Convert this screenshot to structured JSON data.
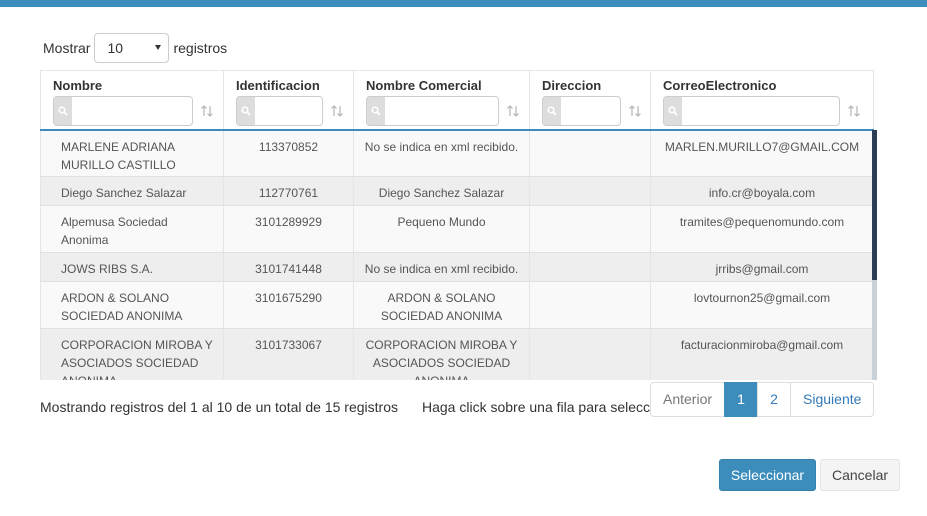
{
  "length": {
    "label_before": "Mostrar",
    "value": "10",
    "label_after": "registros"
  },
  "table": {
    "columns": [
      {
        "label": "Nombre"
      },
      {
        "label": "Identificacion"
      },
      {
        "label": "Nombre Comercial"
      },
      {
        "label": "Direccion"
      },
      {
        "label": "CorreoElectronico"
      }
    ],
    "rows": [
      [
        "MARLENE ADRIANA MURILLO CASTILLO",
        "113370852",
        "No se indica en xml recibido.",
        "",
        "MARLEN.MURILLO7@GMAIL.COM"
      ],
      [
        "Diego Sanchez Salazar",
        "112770761",
        "Diego Sanchez Salazar",
        "",
        "info.cr@boyala.com"
      ],
      [
        "Alpemusa Sociedad Anonima",
        "3101289929",
        "Pequeno Mundo",
        "",
        "tramites@pequenomundo.com"
      ],
      [
        "JOWS RIBS S.A.",
        "3101741448",
        "No se indica en xml recibido.",
        "",
        "jrribs@gmail.com"
      ],
      [
        "ARDON & SOLANO SOCIEDAD ANONIMA",
        "3101675290",
        "ARDON & SOLANO SOCIEDAD ANONIMA",
        "",
        "lovtournon25@gmail.com"
      ],
      [
        "CORPORACION MIROBA Y ASOCIADOS SOCIEDAD ANONIMA",
        "3101733067",
        "CORPORACION MIROBA Y ASOCIADOS SOCIEDAD ANONIMA",
        "",
        "facturacionmiroba@gmail.com"
      ]
    ]
  },
  "info": "Mostrando registros del 1 al 10 de un total de 15 registros",
  "hint": "Haga click sobre una fila para seleccionar",
  "pagination": {
    "prev": "Anterior",
    "page1": "1",
    "page2": "2",
    "next": "Siguiente"
  },
  "buttons": {
    "select": "Seleccionar",
    "cancel": "Cancelar"
  },
  "colors": {
    "accent": "#3c8dbc",
    "row_alt": "#eeeeee"
  }
}
